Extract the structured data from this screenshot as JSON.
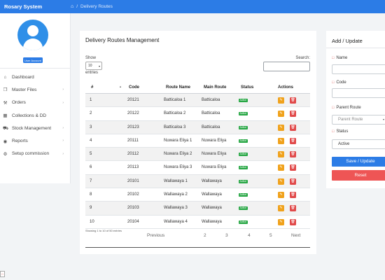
{
  "app": {
    "brand": "Rosary System",
    "home_icon": "home-icon",
    "breadcrumb_sep": "/",
    "breadcrumb": "Delivery Routes"
  },
  "sidebar": {
    "user_badge": "User Account",
    "items": [
      {
        "label": "Dashboard",
        "icon": "⌂",
        "icon_name": "dashboard-icon",
        "chevron": ""
      },
      {
        "label": "Master Files",
        "icon": "❐",
        "icon_name": "master-files-icon",
        "chevron": "›"
      },
      {
        "label": "Orders",
        "icon": "⚒",
        "icon_name": "orders-icon",
        "chevron": "›"
      },
      {
        "label": "Collections & DD",
        "icon": "▦",
        "icon_name": "collections-icon",
        "chevron": ""
      },
      {
        "label": "Stock Management",
        "icon": "⛟",
        "icon_name": "stock-icon",
        "chevron": "›"
      },
      {
        "label": "Reports",
        "icon": "◉",
        "icon_name": "reports-icon",
        "chevron": "›"
      },
      {
        "label": "Setup commission",
        "icon": "⚙",
        "icon_name": "settings-icon",
        "chevron": "›"
      }
    ]
  },
  "main": {
    "title": "Delivery Routes Management",
    "show_label": "Show",
    "page_length": "10",
    "entries_label": "entries",
    "search_label": "Search:",
    "columns": [
      "#",
      "Code",
      "Route Name",
      "Main Route",
      "Status",
      "Actions"
    ],
    "rows": [
      {
        "n": "1",
        "code": "20121",
        "route": "Batticaloa 1",
        "main": "Batticaloa",
        "status": "Active"
      },
      {
        "n": "2",
        "code": "20122",
        "route": "Batticaloa 2",
        "main": "Batticaloa",
        "status": "Active"
      },
      {
        "n": "3",
        "code": "20123",
        "route": "Batticaloa 3",
        "main": "Batticaloa",
        "status": "Active"
      },
      {
        "n": "4",
        "code": "20111",
        "route": "Nuwara Eliya 1",
        "main": "Nuwara Eliya",
        "status": "Active"
      },
      {
        "n": "5",
        "code": "20112",
        "route": "Nuwara Eliya 2",
        "main": "Nuwara Eliya",
        "status": "Active"
      },
      {
        "n": "6",
        "code": "20113",
        "route": "Nuwara Eliya 3",
        "main": "Nuwara Eliya",
        "status": "Active"
      },
      {
        "n": "7",
        "code": "20101",
        "route": "Wallawaya 1",
        "main": "Wallawaya",
        "status": "Active"
      },
      {
        "n": "8",
        "code": "20102",
        "route": "Wallawaya 2",
        "main": "Wallawaya",
        "status": "Active"
      },
      {
        "n": "9",
        "code": "20103",
        "route": "Wallawaya 3",
        "main": "Wallawaya",
        "status": "Active"
      },
      {
        "n": "10",
        "code": "20104",
        "route": "Wallawaya 4",
        "main": "Wallawaya",
        "status": "Active"
      }
    ],
    "info": "Showing 1 to 10 of 50 entries",
    "pagination": {
      "previous": "Previous",
      "pages": [
        "2",
        "3",
        "4",
        "5"
      ],
      "next": "Next"
    }
  },
  "side_form": {
    "title": "Add / Update",
    "name_label": "Name",
    "code_label": "Code",
    "parent_route_label": "Parent Route",
    "parent_route_placeholder": "Parent Route",
    "status_label": "Status",
    "status_value": "Active",
    "save_label": "Save / Update",
    "reset_label": "Reset"
  },
  "colors": {
    "primary": "#2c7ce6",
    "active": "#28a745",
    "edit": "#f0a21c",
    "delete": "#e14a4a",
    "reset": "#ee5555"
  }
}
